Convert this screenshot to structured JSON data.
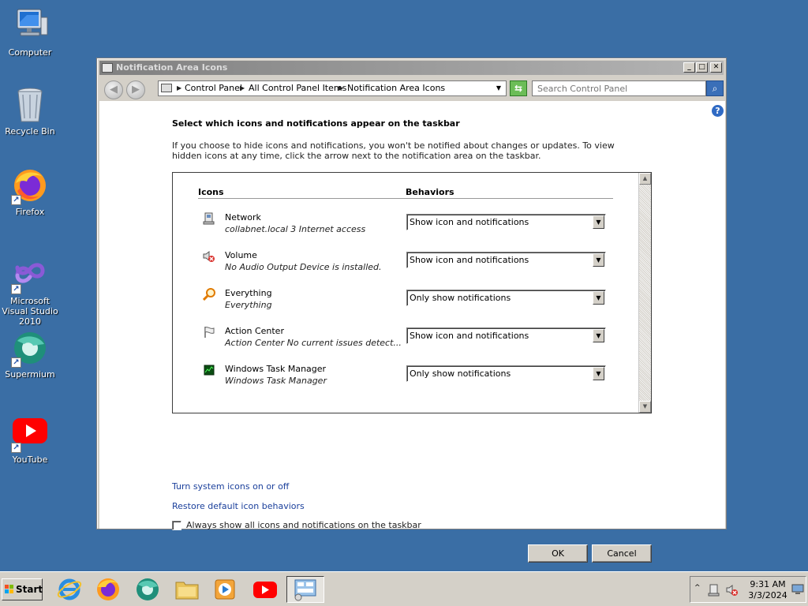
{
  "desktop": {
    "icons": [
      {
        "label": "Computer",
        "icon": "computer-icon"
      },
      {
        "label": "Recycle Bin",
        "icon": "recycle-bin-icon"
      },
      {
        "label": "Firefox",
        "icon": "firefox-icon"
      },
      {
        "label": "Microsoft Visual Studio 2010",
        "icon": "visual-studio-icon"
      },
      {
        "label": "Supermium",
        "icon": "supermium-icon"
      },
      {
        "label": "YouTube",
        "icon": "youtube-icon"
      }
    ]
  },
  "window": {
    "title": "Notification Area Icons",
    "breadcrumbs": [
      "Control Panel",
      "All Control Panel Items",
      "Notification Area Icons"
    ],
    "search_placeholder": "Search Control Panel",
    "heading": "Select which icons and notifications appear on the taskbar",
    "description": "If you choose to hide icons and notifications, you won't be notified about changes or updates. To view hidden icons at any time, click the arrow next to the notification area on the taskbar.",
    "columns": {
      "icons": "Icons",
      "behaviors": "Behaviors"
    },
    "rows": [
      {
        "name": "Network",
        "sub": "collabnet.local  3 Internet access",
        "behavior": "Show icon and notifications",
        "icon": "network-icon"
      },
      {
        "name": "Volume",
        "sub": "No Audio Output Device is installed.",
        "behavior": "Show icon and notifications",
        "icon": "volume-muted-icon"
      },
      {
        "name": "Everything",
        "sub": "Everything",
        "behavior": "Only show notifications",
        "icon": "everything-search-icon"
      },
      {
        "name": "Action Center",
        "sub": "Action Center  No current issues detect...",
        "behavior": "Show icon and notifications",
        "icon": "action-center-flag-icon"
      },
      {
        "name": "Windows Task Manager",
        "sub": "Windows Task Manager",
        "behavior": "Only show notifications",
        "icon": "task-manager-icon"
      }
    ],
    "links": {
      "system_icons": "Turn system icons on or off",
      "restore": "Restore default icon behaviors"
    },
    "checkbox_label": "Always show all icons and notifications on the taskbar",
    "checkbox_checked": false,
    "ok_label": "OK",
    "cancel_label": "Cancel"
  },
  "taskbar": {
    "start_label": "Start",
    "apps": [
      "internet-explorer-icon",
      "firefox-icon",
      "supermium-icon",
      "file-explorer-icon",
      "media-player-icon",
      "youtube-icon",
      "control-panel-icon"
    ],
    "time": "9:31 AM",
    "date": "3/3/2024"
  },
  "colors": {
    "desktop": "#3a6ea5",
    "link": "#1a3f9b",
    "youtube": "#ff0000"
  }
}
